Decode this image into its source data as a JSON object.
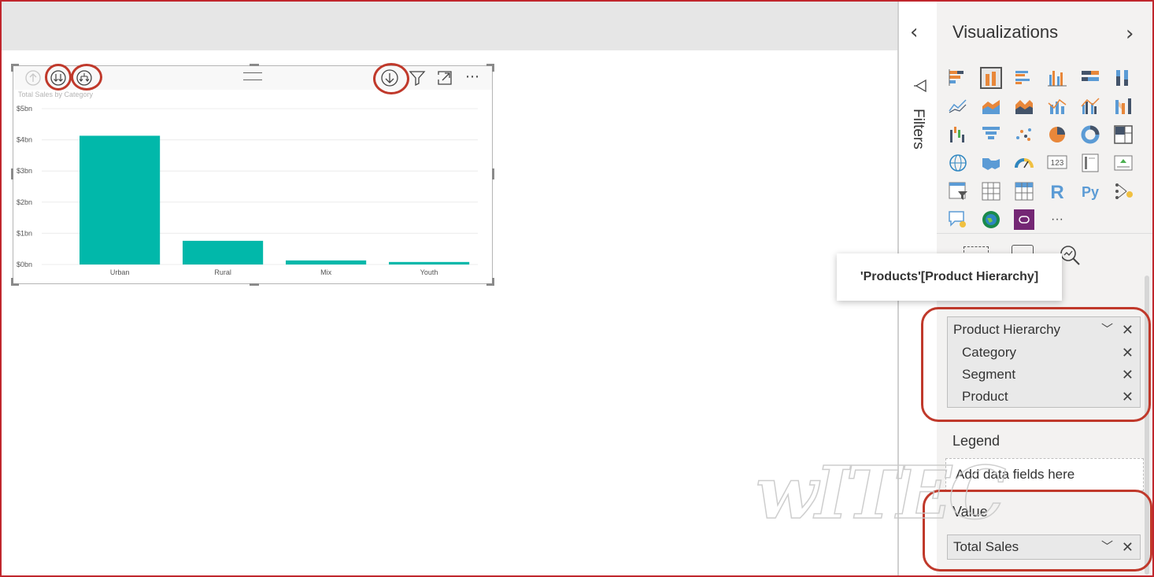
{
  "visual": {
    "title": "Total Sales by Category",
    "icons": [
      "drill-up-icon",
      "drill-down-all-icon",
      "expand-all-icon",
      "drill-mode-icon",
      "filter-icon",
      "focus-mode-icon",
      "more-options-icon"
    ],
    "more_label": "⋯"
  },
  "chart_data": {
    "type": "bar",
    "categories": [
      "Urban",
      "Rural",
      "Mix",
      "Youth"
    ],
    "values": [
      4.13,
      0.76,
      0.13,
      0.08
    ],
    "yticks": [
      "$0bn",
      "$1bn",
      "$2bn",
      "$3bn",
      "$4bn",
      "$5bn"
    ],
    "ylim": [
      0,
      5
    ],
    "bar_color": "#01b8aa",
    "grid": true
  },
  "filters": {
    "collapse_arrow": "‹",
    "label": "Filters"
  },
  "visualizations": {
    "title": "Visualizations",
    "expand_arrow": "›",
    "icons": [
      "stacked-bar-icon",
      "stacked-column-icon",
      "clustered-bar-icon",
      "clustered-column-icon",
      "100pct-bar-icon",
      "100pct-column-icon",
      "line-chart-icon",
      "area-chart-icon",
      "stacked-area-icon",
      "line-column-icon",
      "line-clustered-column-icon",
      "ribbon-chart-icon",
      "waterfall-icon",
      "funnel-icon",
      "scatter-icon",
      "pie-chart-icon",
      "donut-chart-icon",
      "treemap-icon",
      "map-icon",
      "filled-map-icon",
      "gauge-icon",
      "card-icon",
      "multirow-card-icon",
      "kpi-icon",
      "slicer-icon",
      "table-icon",
      "matrix-icon",
      "r-visual-icon",
      "python-visual-icon",
      "key-influencers-icon",
      "qa-icon",
      "arcgis-map-icon",
      "power-apps-icon",
      "more-visuals-icon"
    ],
    "r_label": "R",
    "py_label": "Py",
    "card_label": "123",
    "more_label": "···"
  },
  "tooltip": "'Products'[Product Hierarchy]",
  "axis_well": {
    "header": "Product Hierarchy",
    "items": [
      "Category",
      "Segment",
      "Product"
    ]
  },
  "legend_well": {
    "label": "Legend",
    "placeholder": "Add data fields here"
  },
  "value_well": {
    "label": "Value",
    "field": "Total Sales"
  },
  "glyphs": {
    "close": "✕",
    "chevron": "﹀"
  },
  "colors": {
    "accent_red": "#c0392b",
    "bar": "#01b8aa"
  }
}
